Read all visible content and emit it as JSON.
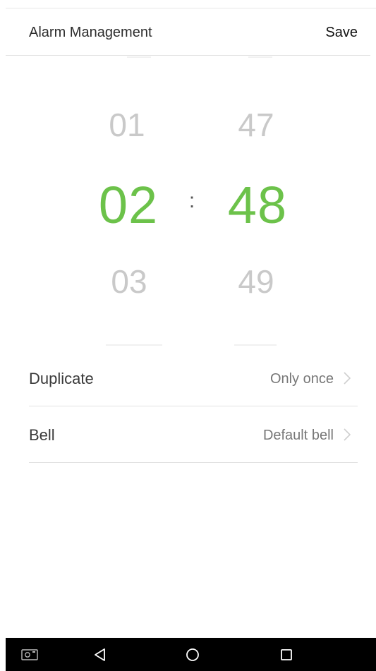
{
  "header": {
    "title": "Alarm Management",
    "save_label": "Save"
  },
  "time_picker": {
    "hour": {
      "prev": "01",
      "selected": "02",
      "next": "03"
    },
    "separator": ":",
    "minute": {
      "prev": "47",
      "selected": "48",
      "next": "49"
    }
  },
  "settings": [
    {
      "label": "Duplicate",
      "value": "Only once"
    },
    {
      "label": "Bell",
      "value": "Default bell"
    }
  ],
  "nav_bar": {
    "icons": [
      "screenshot-icon",
      "back-icon",
      "home-icon",
      "recents-icon"
    ]
  },
  "colors": {
    "accent": "#6cc24a",
    "nav_background": "#000000"
  }
}
